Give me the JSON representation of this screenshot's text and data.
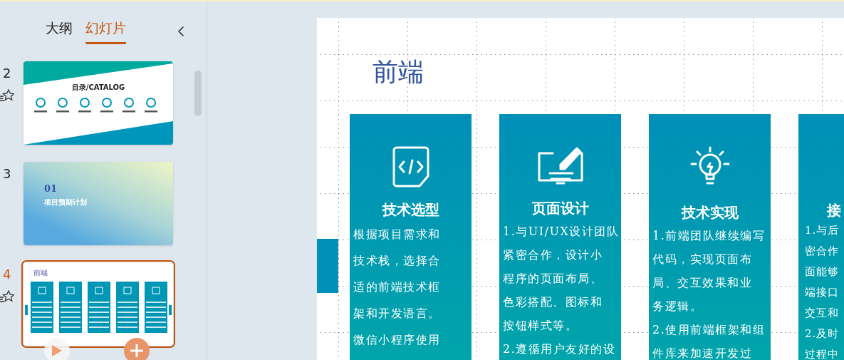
{
  "panel_tabs": [
    {
      "label": "大纲",
      "selected": false
    },
    {
      "label": "幻灯片",
      "selected": true
    }
  ],
  "slides": [
    {
      "number": "2",
      "kind": "catalog",
      "selected": false,
      "star": true,
      "title": "目录/CATALOG"
    },
    {
      "number": "3",
      "kind": "section",
      "selected": false,
      "star": false,
      "index": "01",
      "title": "项目预期计划"
    },
    {
      "number": "4",
      "kind": "content",
      "selected": true,
      "star": true,
      "title": "前端"
    }
  ],
  "slide": {
    "title": "前端",
    "cards": [
      {
        "kind": "code",
        "title": "技术选型",
        "lines": [
          "根据项目需求和",
          "技术栈，选择合",
          "适的前端技术框",
          "架和开发语言。",
          "微信小程序使用"
        ]
      },
      {
        "kind": "design",
        "title": "页面设计",
        "lines": [
          "1.与UI/UX设计团队",
          "紧密合作，设计小",
          "程序的页面布局、",
          "色彩搭配、图标和",
          "按钮样式等。",
          "2.遵循用户友好的设"
        ]
      },
      {
        "kind": "bulb",
        "title": "技术实现",
        "lines": [
          "1.前端团队继续编写",
          "代码，实现页面布",
          "局、交互效果和业",
          "务逻辑。",
          "2.使用前端框架和组",
          "件库来加速开发过"
        ]
      },
      {
        "kind": "cut",
        "title": "接",
        "lines": [
          "1.与后",
          "密合作",
          "面能够",
          "端接口",
          "交互和",
          "2.及时",
          "过程中"
        ]
      }
    ]
  }
}
